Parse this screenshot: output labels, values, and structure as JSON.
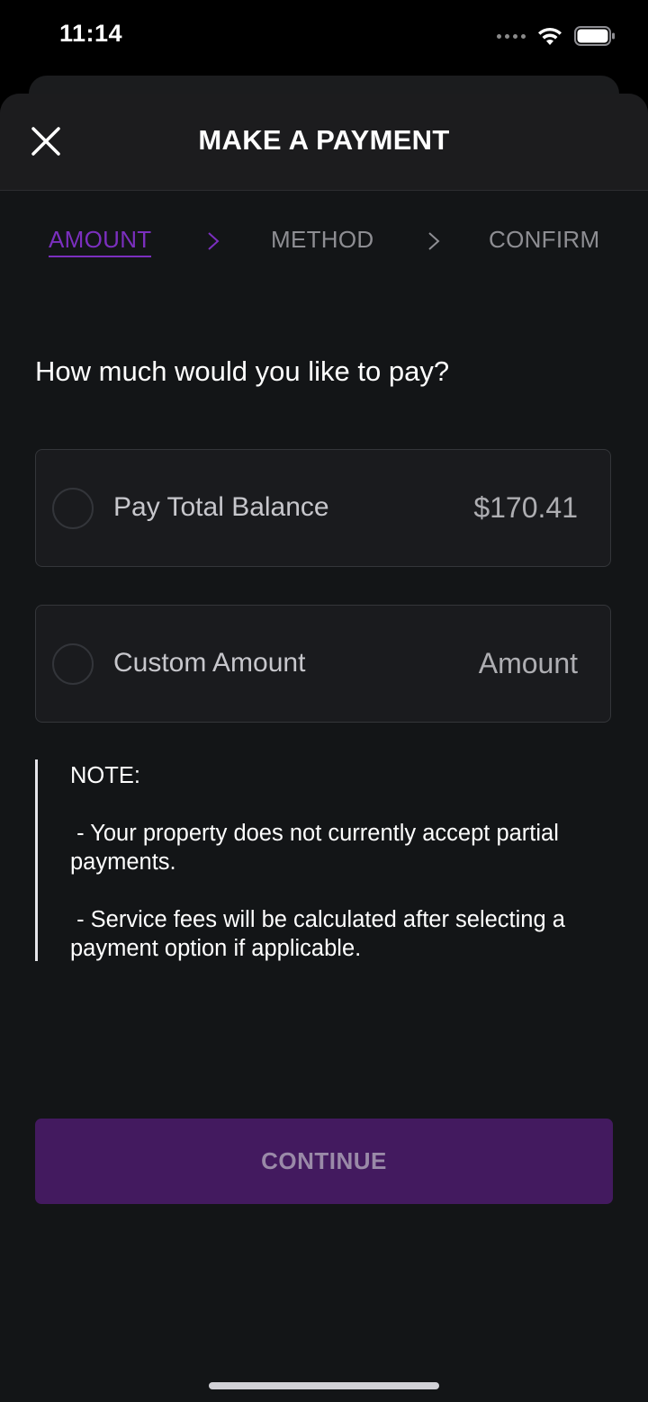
{
  "status_bar": {
    "time": "11:14",
    "icons": [
      "signal-dots-icon",
      "wifi-icon",
      "battery-icon"
    ]
  },
  "header": {
    "title": "MAKE A PAYMENT",
    "close_icon": "close-icon"
  },
  "steps": [
    {
      "label": "AMOUNT",
      "active": true
    },
    {
      "label": "METHOD",
      "active": false
    },
    {
      "label": "CONFIRM",
      "active": false
    }
  ],
  "main": {
    "question": "How much would you like to pay?",
    "options": [
      {
        "label": "Pay Total Balance",
        "value": "$170.41",
        "selected": false
      },
      {
        "label": "Custom Amount",
        "placeholder": "Amount",
        "value": "",
        "selected": false
      }
    ],
    "note": {
      "heading": "NOTE:",
      "line1": " - Your property does not currently accept partial payments.",
      "line2": " - Service fees will be calculated after selecting a payment option if applicable."
    },
    "continue_label": "CONTINUE"
  },
  "colors": {
    "accent": "#7b2fbf",
    "button_bg": "#431a5f",
    "background": "#131517"
  }
}
